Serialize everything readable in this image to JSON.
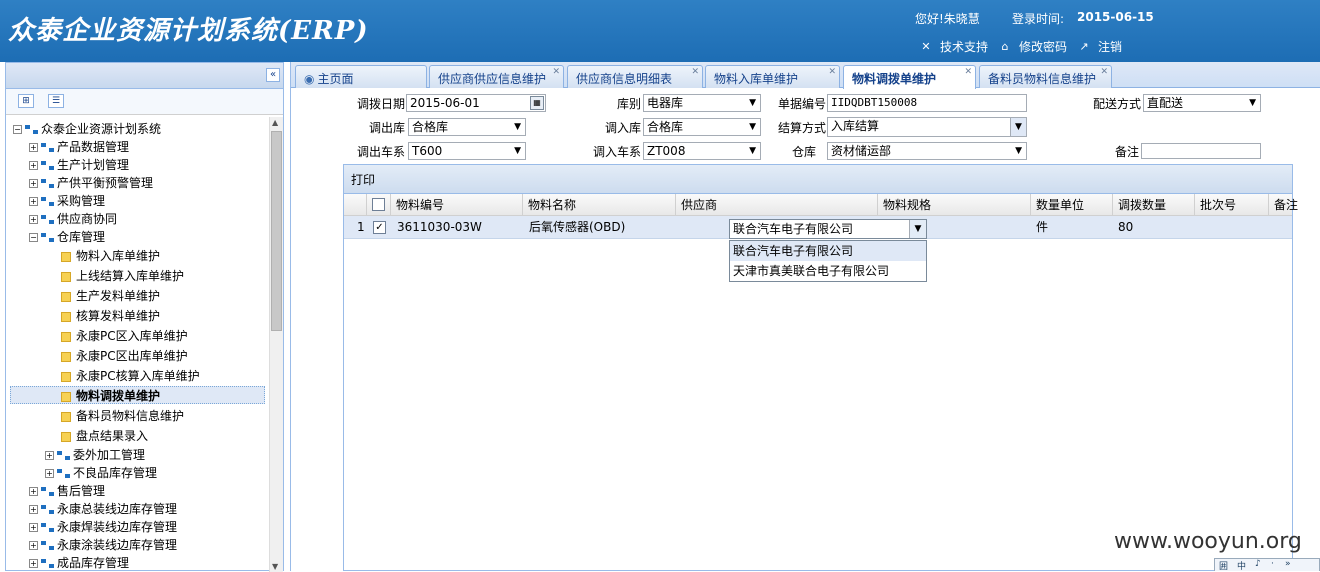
{
  "header": {
    "title": "众泰企业资源计划系统(ERP)",
    "greeting": "您好!朱晓慧",
    "login_label": "登录时间:",
    "login_time": "2015-06-15",
    "links": [
      "技术支持",
      "修改密码",
      "注销"
    ]
  },
  "sidebar": {
    "collapse_icon": "double-chevron-left-icon",
    "tree": [
      "众泰企业资源计划系统",
      "产品数据管理",
      "生产计划管理",
      "产供平衡预警管理",
      "采购管理",
      "供应商协同",
      "仓库管理",
      "物料入库单维护",
      "上线结算入库单维护",
      "生产发料单维护",
      "核算发料单维护",
      "永康PC区入库单维护",
      "永康PC区出库单维护",
      "永康PC核算入库单维护",
      "物料调拨单维护",
      "备料员物料信息维护",
      "盘点结果录入",
      "委外加工管理",
      "不良品库存管理",
      "售后管理",
      "永康总装线边库存管理",
      "永康焊装线边库存管理",
      "永康涂装线边库存管理",
      "成品库存管理"
    ]
  },
  "tabs": [
    {
      "label": "主页面"
    },
    {
      "label": "供应商供应信息维护"
    },
    {
      "label": "供应商信息明细表"
    },
    {
      "label": "物料入库单维护"
    },
    {
      "label": "物料调拨单维护",
      "active": true
    },
    {
      "label": "备料员物料信息维护"
    }
  ],
  "form": {
    "date_label": "调拨日期",
    "date_value": "2015-06-01",
    "warehouse_type_label": "库别",
    "warehouse_type_value": "电器库",
    "doc_no_label": "单据编号",
    "doc_no_value": "IIDQDBT150008",
    "delivery_label": "配送方式",
    "delivery_value": "直配送",
    "out_wh_label": "调出库",
    "out_wh_value": "合格库",
    "in_wh_label": "调入库",
    "in_wh_value": "合格库",
    "settle_label": "结算方式",
    "settle_value": "入库结算",
    "out_sys_label": "调出车系",
    "out_sys_value": "T600",
    "in_sys_label": "调入车系",
    "in_sys_value": "ZT008",
    "store_label": "仓库",
    "store_value": "资材储运部",
    "remark_label": "备注",
    "remark_value": ""
  },
  "grid": {
    "toolbar_print": "打印",
    "columns": [
      "物料编号",
      "物料名称",
      "供应商",
      "物料规格",
      "数量单位",
      "调拨数量",
      "批次号",
      "备注"
    ],
    "rows": [
      {
        "no": "1",
        "checked": true,
        "material_code": "3611030-03W",
        "material_name": "后氧传感器(OBD)",
        "supplier": "联合汽车电子有限公司",
        "spec": "",
        "unit": "件",
        "qty": "80",
        "batch": "",
        "remark": ""
      }
    ],
    "supplier_options": [
      "联合汽车电子有限公司",
      "天津市真美联合电子有限公司"
    ]
  },
  "watermark": "www.wooyun.org",
  "ime_bar": [
    "囲",
    "中",
    "♪",
    "·",
    "»"
  ]
}
